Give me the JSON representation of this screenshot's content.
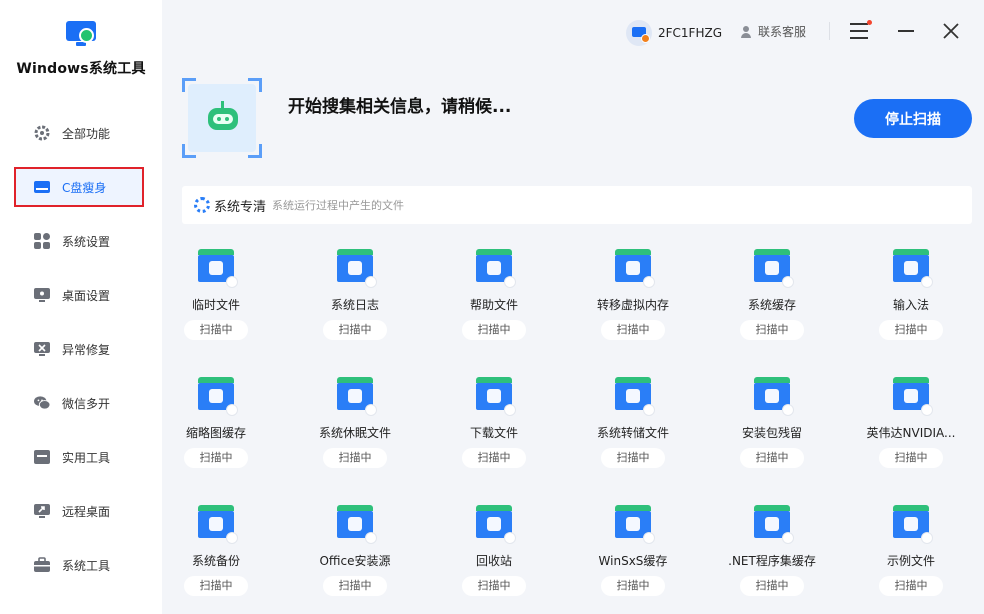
{
  "app": {
    "title": "Windows系统工具"
  },
  "sidebar": {
    "items": [
      {
        "label": "全部功能",
        "icon": "gear-icon"
      },
      {
        "label": "C盘瘦身",
        "icon": "disk-icon",
        "active": true
      },
      {
        "label": "系统设置",
        "icon": "grid-icon"
      },
      {
        "label": "桌面设置",
        "icon": "monitor-icon"
      },
      {
        "label": "异常修复",
        "icon": "repair-icon"
      },
      {
        "label": "微信多开",
        "icon": "wechat-icon"
      },
      {
        "label": "实用工具",
        "icon": "toolbox-icon"
      },
      {
        "label": "远程桌面",
        "icon": "remote-icon"
      },
      {
        "label": "系统工具",
        "icon": "briefcase-icon"
      }
    ]
  },
  "topbar": {
    "user": "2FC1FHZG",
    "support": "联系客服"
  },
  "scan": {
    "title": "开始搜集相关信息，请稍候...",
    "stop_button": "停止扫描"
  },
  "section": {
    "title": "系统专清",
    "subtitle": "系统运行过程中产生的文件"
  },
  "colors": {
    "accent": "#1b6ff5",
    "green": "#2ec07b",
    "active_border": "#e0222a"
  },
  "items": [
    {
      "label": "临时文件",
      "status": "扫描中"
    },
    {
      "label": "系统日志",
      "status": "扫描中"
    },
    {
      "label": "帮助文件",
      "status": "扫描中"
    },
    {
      "label": "转移虚拟内存",
      "status": "扫描中"
    },
    {
      "label": "系统缓存",
      "status": "扫描中"
    },
    {
      "label": "输入法",
      "status": "扫描中"
    },
    {
      "label": "缩略图缓存",
      "status": "扫描中"
    },
    {
      "label": "系统休眠文件",
      "status": "扫描中"
    },
    {
      "label": "下载文件",
      "status": "扫描中"
    },
    {
      "label": "系统转储文件",
      "status": "扫描中"
    },
    {
      "label": "安装包残留",
      "status": "扫描中"
    },
    {
      "label": "英伟达NVIDIA...",
      "status": "扫描中"
    },
    {
      "label": "系统备份",
      "status": "扫描中"
    },
    {
      "label": "Office安装源",
      "status": "扫描中"
    },
    {
      "label": "回收站",
      "status": "扫描中"
    },
    {
      "label": "WinSxS缓存",
      "status": "扫描中"
    },
    {
      "label": ".NET程序集缓存",
      "status": "扫描中"
    },
    {
      "label": "示例文件",
      "status": "扫描中"
    }
  ]
}
